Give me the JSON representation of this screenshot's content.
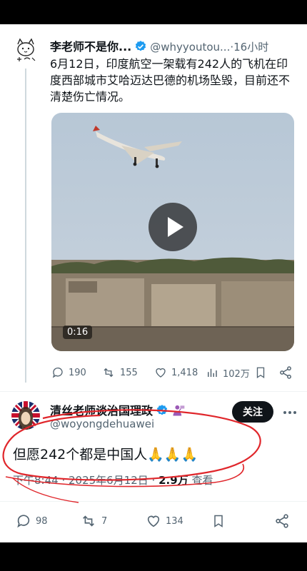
{
  "quoted_tweet": {
    "author_name": "李老师不是你...",
    "handle": "@whyyoutou...",
    "separator": "·",
    "time": "16小时",
    "text": "6月12日，印度航空一架载有242人的飞机在印度西部城市艾哈迈达巴德的机场坠毁，目前还不清楚伤亡情况。",
    "video_duration": "0:16",
    "actions": {
      "replies": "190",
      "retweets": "155",
      "likes": "1,418",
      "views": "102万"
    }
  },
  "reply_tweet": {
    "author_name": "清丝老师谈治国理政",
    "handle": "@woyongdehuawei",
    "follow_label": "关注",
    "text": "但愿242个都是中国人🙏🙏🙏",
    "meta_time": "下午8:44 · 2025年6月12日 · ",
    "meta_views": "2.9万",
    "meta_views_label": " 查看",
    "actions": {
      "replies": "98",
      "retweets": "7",
      "likes": "134"
    }
  },
  "colors": {
    "verified_blue": "#1d9bf0",
    "annotation_red": "#e0262b",
    "muted_text": "#536471"
  }
}
